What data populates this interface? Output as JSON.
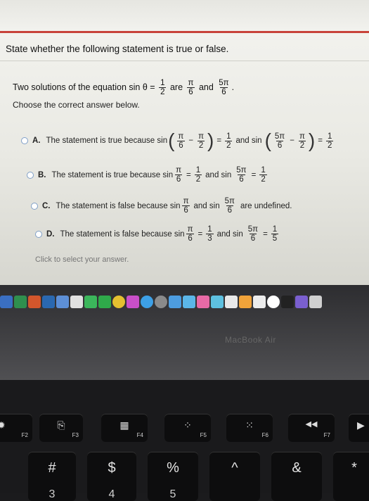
{
  "page": {
    "title": "State whether the following statement is true or false.",
    "question_prefix": "Two solutions of the equation sin θ =",
    "q_frac1": {
      "num": "1",
      "den": "2"
    },
    "are": "are",
    "q_frac2": {
      "num": "π",
      "den": "6"
    },
    "and": "and",
    "q_frac3": {
      "num": "5π",
      "den": "6"
    },
    "period": ".",
    "choose": "Choose the correct answer below.",
    "hint": "Click to select your answer."
  },
  "options": {
    "a": {
      "letter": "A.",
      "text": "The statement is true because sin",
      "f1": {
        "num": "π",
        "den": "6"
      },
      "minus": "−",
      "f2": {
        "num": "π",
        "den": "2"
      },
      "eq": "=",
      "f3": {
        "num": "1",
        "den": "2"
      },
      "and": "and sin",
      "f4": {
        "num": "5π",
        "den": "6"
      },
      "f5": {
        "num": "π",
        "den": "2"
      },
      "f6": {
        "num": "1",
        "den": "2"
      }
    },
    "b": {
      "letter": "B.",
      "text": "The statement is true because sin",
      "f1": {
        "num": "π",
        "den": "6"
      },
      "eq": "=",
      "f2": {
        "num": "1",
        "den": "2"
      },
      "and": "and sin",
      "f3": {
        "num": "5π",
        "den": "6"
      },
      "f4": {
        "num": "1",
        "den": "2"
      }
    },
    "c": {
      "letter": "C.",
      "text": "The statement is false because sin",
      "f1": {
        "num": "π",
        "den": "6"
      },
      "and": "and sin",
      "f2": {
        "num": "5π",
        "den": "6"
      },
      "tail": "are undefined."
    },
    "d": {
      "letter": "D.",
      "text": "The statement is false because sin",
      "f1": {
        "num": "π",
        "den": "6"
      },
      "eq": "=",
      "f2": {
        "num": "1",
        "den": "3"
      },
      "and": "and sin",
      "f3": {
        "num": "5π",
        "den": "6"
      },
      "f4": {
        "num": "1",
        "den": "5"
      }
    }
  },
  "laptop": {
    "brand": "MacBook Air"
  },
  "keys": {
    "f2": "F2",
    "f3": "F3",
    "f4": "F4",
    "f5": "F5",
    "f6": "F6",
    "f7": "F7",
    "hash": "#",
    "three": "3",
    "dollar": "$",
    "four": "4",
    "percent": "%",
    "five": "5",
    "caret": "^",
    "amp": "&",
    "star": "*",
    "mission_control": "⎘",
    "launchpad": "▦",
    "kbd_dim": "⁘",
    "kbd_bright": "⁙",
    "rewind": "◀◀",
    "play": "▶"
  },
  "colors": {
    "radio_border": "#7f9fc7",
    "accent_red": "#c8433a"
  }
}
